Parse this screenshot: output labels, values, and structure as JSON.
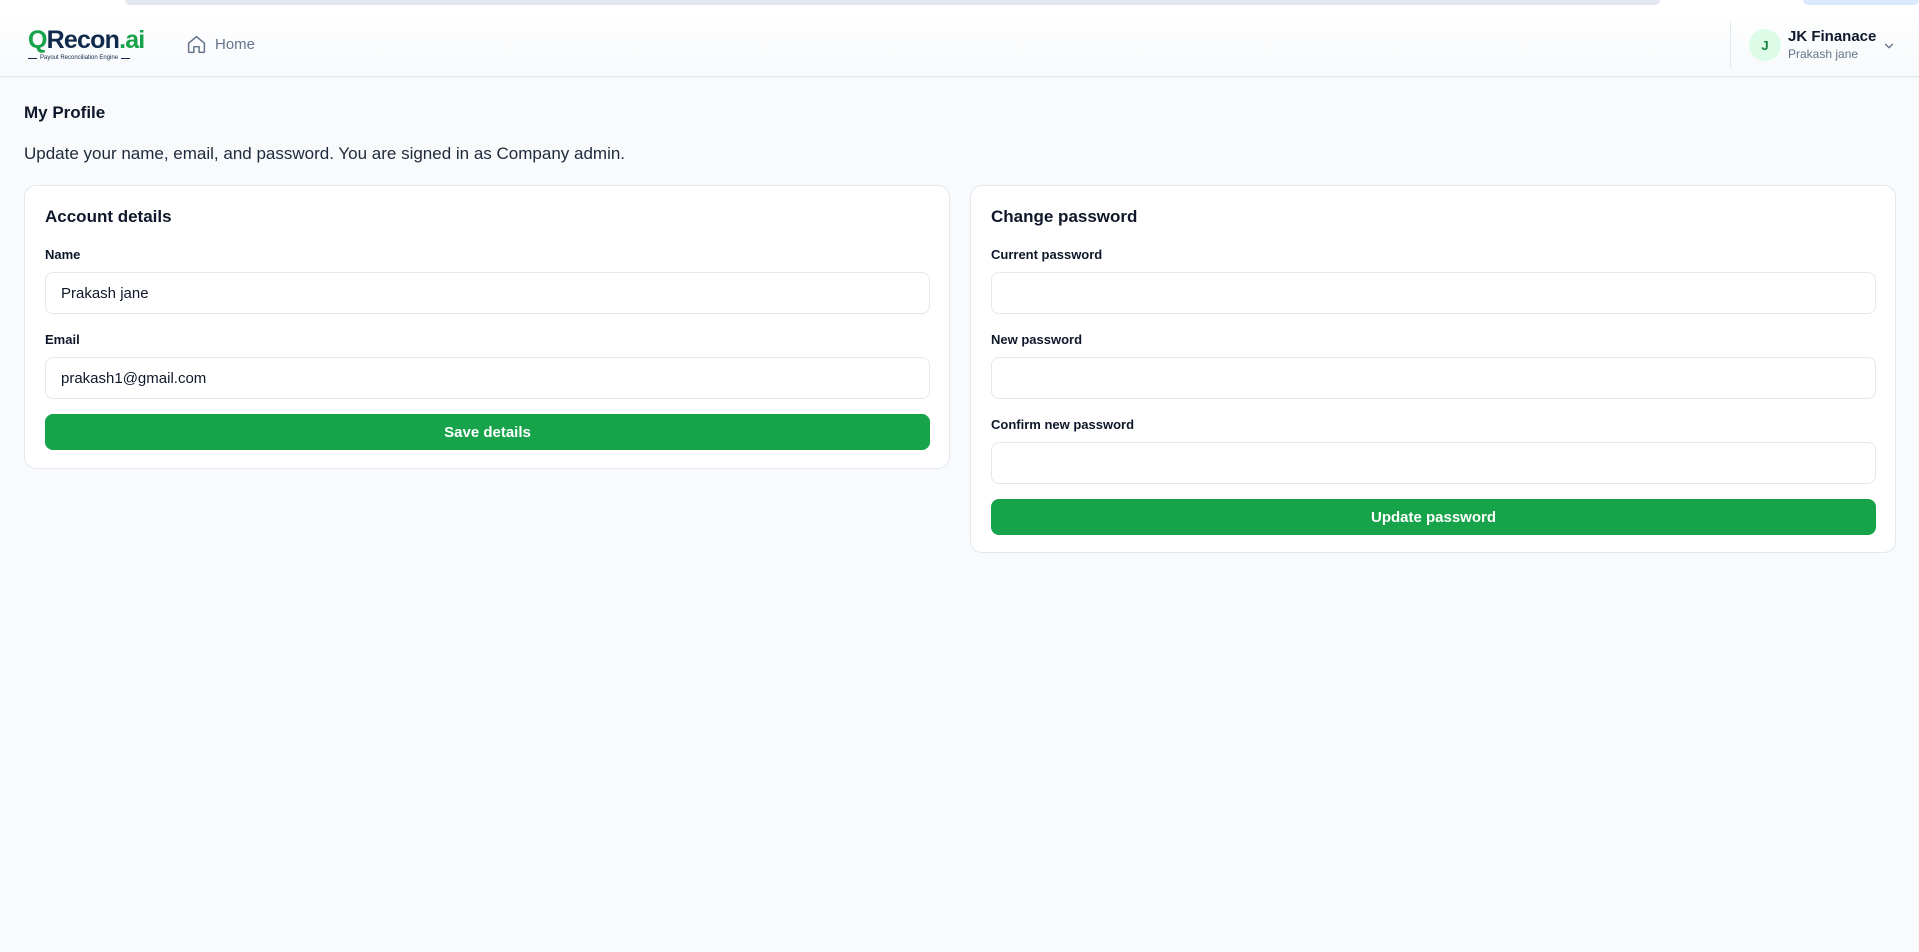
{
  "brand": {
    "logo_q": "Q",
    "logo_recon": "Recon",
    "logo_ai": ".ai",
    "tagline": "Payout Reconciliation Engine"
  },
  "nav": {
    "home_label": "Home"
  },
  "user": {
    "avatar_initial": "J",
    "company": "JK Finanace",
    "name": "Prakash jane"
  },
  "page": {
    "title": "My Profile",
    "subtitle": "Update your name, email, and password. You are signed in as Company admin."
  },
  "account_details": {
    "title": "Account details",
    "name_label": "Name",
    "name_value": "Prakash jane",
    "email_label": "Email",
    "email_value": "prakash1@gmail.com",
    "save_label": "Save details"
  },
  "change_password": {
    "title": "Change password",
    "current_label": "Current password",
    "current_value": "",
    "new_label": "New password",
    "new_value": "",
    "confirm_label": "Confirm new password",
    "confirm_value": "",
    "update_label": "Update password"
  },
  "colors": {
    "accent": "#16a34a",
    "background": "#f8fafc",
    "text": "#0f172a",
    "muted": "#64748b",
    "border": "#e2e8f0"
  },
  "icons": {
    "home": "home-icon",
    "chevron": "chevron-down-icon"
  }
}
